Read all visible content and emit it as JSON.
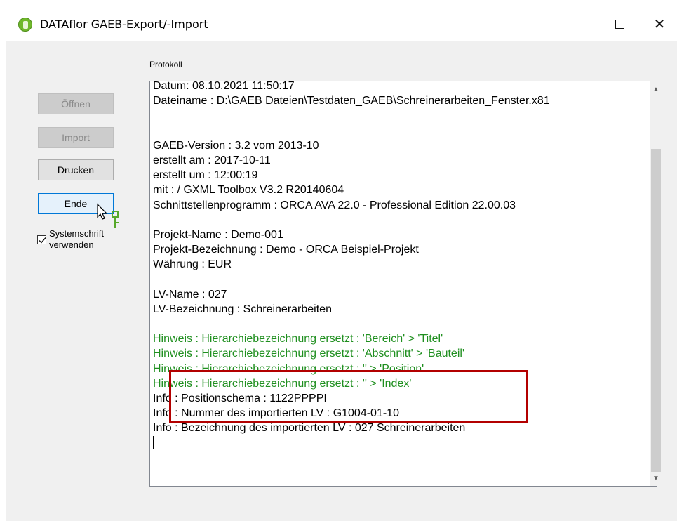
{
  "window": {
    "title": "DATAflor GAEB-Export/-Import",
    "controls": {
      "minimize": "minimize",
      "maximize": "maximize",
      "close": "close"
    }
  },
  "protokoll_label": "Protokoll",
  "buttons": {
    "open": "Öffnen",
    "import": "Import",
    "print": "Drucken",
    "end": "Ende"
  },
  "checkbox": {
    "label_line1": "Systemschrift",
    "label_line2": "verwenden",
    "checked": true
  },
  "log_lines": [
    {
      "text": "Datum: 08.10.2021 11:50:17",
      "type": "normal"
    },
    {
      "text": "Dateiname : D:\\GAEB Dateien\\Testdaten_GAEB\\Schreinerarbeiten_Fenster.x81",
      "type": "normal"
    },
    {
      "text": "",
      "type": "normal"
    },
    {
      "text": "",
      "type": "normal"
    },
    {
      "text": "GAEB-Version : 3.2 vom 2013-10",
      "type": "normal"
    },
    {
      "text": "erstellt am : 2017-10-11",
      "type": "normal"
    },
    {
      "text": "erstellt um : 12:00:19",
      "type": "normal"
    },
    {
      "text": "mit : / GXML Toolbox V3.2 R20140604",
      "type": "normal"
    },
    {
      "text": "Schnittstellenprogramm : ORCA AVA 22.0 - Professional Edition 22.00.03",
      "type": "normal"
    },
    {
      "text": "",
      "type": "normal"
    },
    {
      "text": "Projekt-Name : Demo-001",
      "type": "normal"
    },
    {
      "text": "Projekt-Bezeichnung : Demo - ORCA Beispiel-Projekt",
      "type": "normal"
    },
    {
      "text": "Währung : EUR",
      "type": "normal"
    },
    {
      "text": "",
      "type": "normal"
    },
    {
      "text": "LV-Name : 027",
      "type": "normal"
    },
    {
      "text": "LV-Bezeichnung : Schreinerarbeiten",
      "type": "normal"
    },
    {
      "text": "",
      "type": "normal"
    },
    {
      "text": "Hinweis : Hierarchiebezeichnung ersetzt : 'Bereich' > 'Titel'",
      "type": "hint"
    },
    {
      "text": "Hinweis : Hierarchiebezeichnung ersetzt : 'Abschnitt' > 'Bauteil'",
      "type": "hint"
    },
    {
      "text": "Hinweis : Hierarchiebezeichnung ersetzt : '' > 'Position'",
      "type": "hint"
    },
    {
      "text": "Hinweis : Hierarchiebezeichnung ersetzt : '' > 'Index'",
      "type": "hint"
    },
    {
      "text": "Info : Positionschema : 1122PPPPI",
      "type": "normal"
    },
    {
      "text": "Info : Nummer des importierten LV : G1004-01-10",
      "type": "normal"
    },
    {
      "text": "Info : Bezeichnung des importierten LV : 027 Schreinerarbeiten",
      "type": "normal"
    }
  ],
  "colors": {
    "hint_text": "#1f8f1f",
    "highlight_border": "#b30000",
    "focus_border": "#0078d7"
  }
}
